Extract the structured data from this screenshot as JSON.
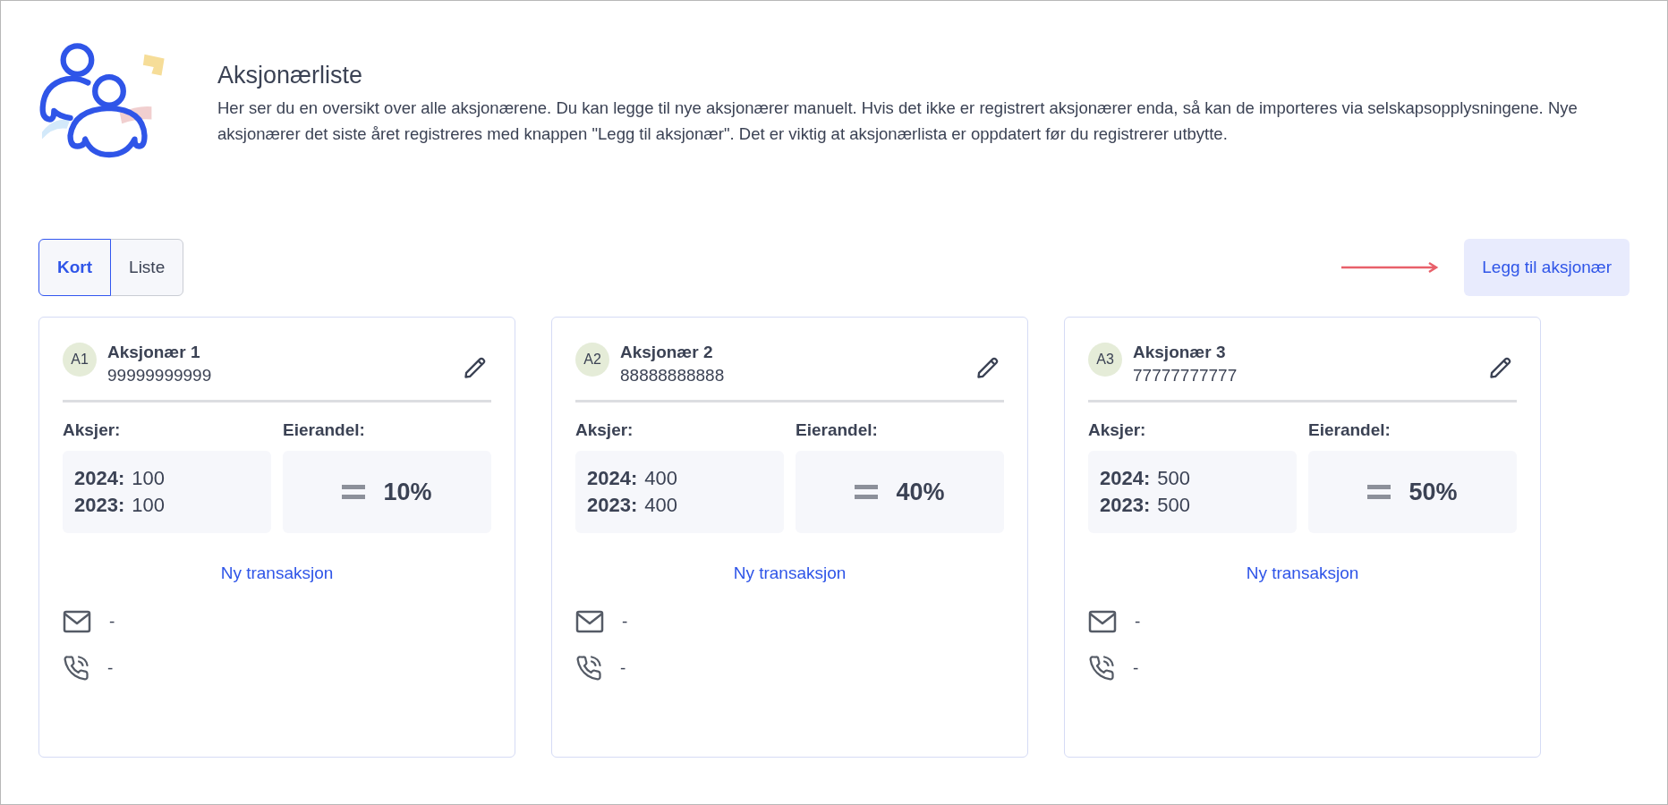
{
  "header": {
    "title": "Aksjonærliste",
    "description": "Her ser du en oversikt over alle aksjonærene. Du kan legge til nye aksjonærer manuelt. Hvis det ikke er registrert aksjonærer enda, så kan de importeres via selskapsopplysningene. Nye aksjonærer det siste året registreres med knappen \"Legg til aksjonær\". Det er viktig at aksjonærlista er oppdatert før du registrerer utbytte."
  },
  "view_toggle": [
    {
      "label": "Kort",
      "selected": true
    },
    {
      "label": "Liste",
      "selected": false
    }
  ],
  "add_button": "Legg til aksjonær",
  "cards": [
    {
      "initials": "A1",
      "name": "Aksjonær 1",
      "id_number": "99999999999",
      "shares_label": "Aksjer:",
      "ownership_label": "Eierandel:",
      "shares": [
        {
          "year": "2024:",
          "count": "100"
        },
        {
          "year": "2023:",
          "count": "100"
        }
      ],
      "ownership": "10%",
      "link": "Ny transaksjon",
      "email": "-",
      "phone": "-"
    },
    {
      "initials": "A2",
      "name": "Aksjonær 2",
      "id_number": "88888888888",
      "shares_label": "Aksjer:",
      "ownership_label": "Eierandel:",
      "shares": [
        {
          "year": "2024:",
          "count": "400"
        },
        {
          "year": "2023:",
          "count": "400"
        }
      ],
      "ownership": "40%",
      "link": "Ny transaksjon",
      "email": "-",
      "phone": "-"
    },
    {
      "initials": "A3",
      "name": "Aksjonær 3",
      "id_number": "77777777777",
      "shares_label": "Aksjer:",
      "ownership_label": "Eierandel:",
      "shares": [
        {
          "year": "2024:",
          "count": "500"
        },
        {
          "year": "2023:",
          "count": "500"
        }
      ],
      "ownership": "50%",
      "link": "Ny transaksjon",
      "email": "-",
      "phone": "-"
    }
  ]
}
